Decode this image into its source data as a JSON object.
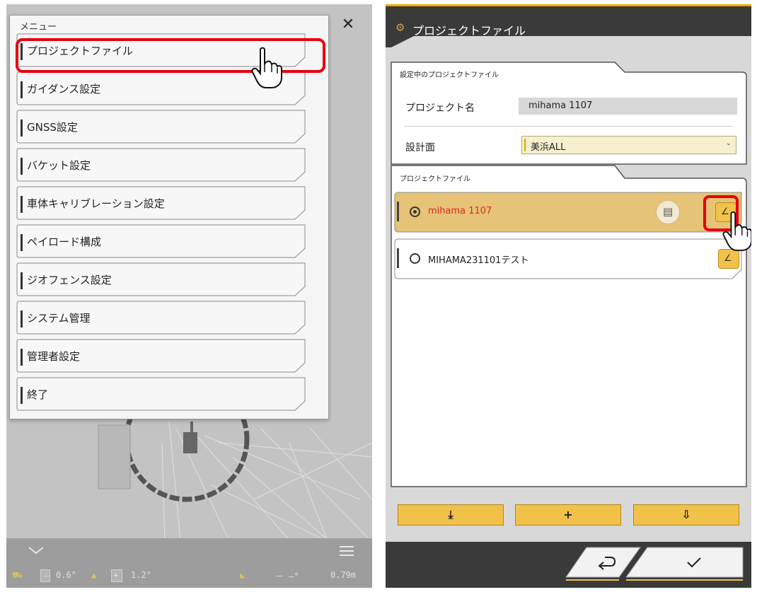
{
  "left": {
    "menu": {
      "title": "メニュー",
      "items": [
        {
          "label": "プロジェクトファイル",
          "highlighted": true
        },
        {
          "label": "ガイダンス設定"
        },
        {
          "label": "GNSS設定"
        },
        {
          "label": "バケット設定"
        },
        {
          "label": "車体キャリブレーション設定"
        },
        {
          "label": "ペイロード構成"
        },
        {
          "label": "ジオフェンス設定"
        },
        {
          "label": "システム管理"
        },
        {
          "label": "管理者設定"
        },
        {
          "label": "終了"
        }
      ],
      "close_icon": "close-icon"
    },
    "status_bar": {
      "pitch_value": "0.6°",
      "roll_value": "1.2°",
      "offset_value": "－ ‒°",
      "height_value": "0.79m",
      "minus_sign": "－",
      "plus_sign": "+"
    }
  },
  "right": {
    "header": {
      "title": "プロジェクトファイル",
      "icon": "gear-icon"
    },
    "current_section": {
      "label": "設定中のプロジェクトファイル",
      "project_name_label": "プロジェクト名",
      "project_name_value": "mihama 1107",
      "design_surface_label": "設計面",
      "design_surface_value": "美浜ALL"
    },
    "files_section": {
      "label": "プロジェクトファイル",
      "files": [
        {
          "name": "mihama 1107",
          "selected": true
        },
        {
          "name": "MIHAMA231101テスト",
          "selected": false
        }
      ]
    },
    "toolbar": {
      "import_label": "⤓",
      "add_label": "+",
      "folder_label": "⇩"
    },
    "nav": {
      "back_icon": "back-icon",
      "confirm_icon": "check-icon"
    }
  },
  "colors": {
    "accent_yellow": "#f2c14a",
    "highlight_red": "#e60012",
    "selected_row": "#e6c376",
    "selected_text": "#d62b1f",
    "header_dark": "#3a3a3a"
  }
}
